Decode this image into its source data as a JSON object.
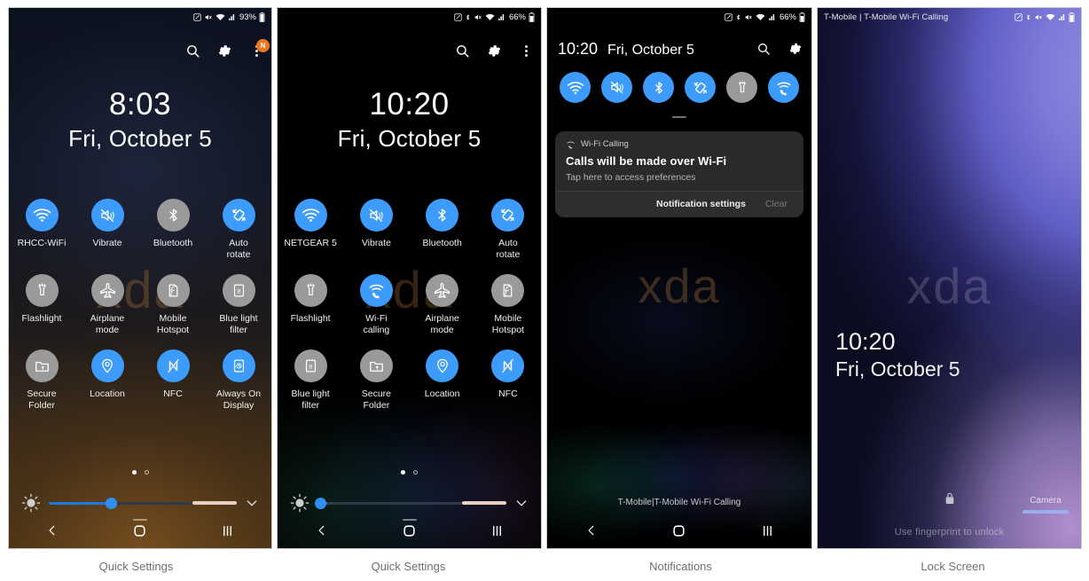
{
  "panels": [
    {
      "caption": "Quick Settings",
      "status": {
        "carrier": "",
        "battery_percent": "93%",
        "icons": [
          "nfc-icon",
          "mute-icon",
          "wifi-icon",
          "signal-icon",
          "battery-icon"
        ]
      },
      "header_icons": [
        "search-icon",
        "gear-icon",
        "more-options-icon"
      ],
      "badge": "N",
      "clock": {
        "time": "8:03",
        "date": "Fri, October 5"
      },
      "watermark": "xda",
      "tiles": [
        {
          "label": "RHCC-WiFi",
          "icon": "wifi-icon",
          "state": "on"
        },
        {
          "label": "Vibrate",
          "icon": "vibrate-icon",
          "state": "on"
        },
        {
          "label": "Bluetooth",
          "icon": "bluetooth-icon",
          "state": "off"
        },
        {
          "label": "Auto\nrotate",
          "icon": "auto-rotate-icon",
          "state": "on"
        },
        {
          "label": "Flashlight",
          "icon": "flashlight-icon",
          "state": "off"
        },
        {
          "label": "Airplane\nmode",
          "icon": "airplane-icon",
          "state": "off"
        },
        {
          "label": "Mobile\nHotspot",
          "icon": "hotspot-icon",
          "state": "off"
        },
        {
          "label": "Blue light\nfilter",
          "icon": "blue-light-filter-icon",
          "state": "off"
        },
        {
          "label": "Secure\nFolder",
          "icon": "secure-folder-icon",
          "state": "off"
        },
        {
          "label": "Location",
          "icon": "location-icon",
          "state": "on"
        },
        {
          "label": "NFC",
          "icon": "nfc-icon",
          "state": "on"
        },
        {
          "label": "Always On\nDisplay",
          "icon": "always-on-display-icon",
          "state": "on"
        }
      ],
      "pager": {
        "pages": 2,
        "active": 0
      },
      "brightness": {
        "value_percent": 33
      },
      "nav": [
        "back-button",
        "home-button",
        "recents-button"
      ]
    },
    {
      "caption": "Quick Settings",
      "status": {
        "carrier": "",
        "battery_percent": "66%",
        "icons": [
          "nfc-icon",
          "bluetooth-icon",
          "mute-icon",
          "wifi-icon",
          "signal-icon",
          "battery-icon"
        ]
      },
      "header_icons": [
        "search-icon",
        "gear-icon",
        "more-options-icon"
      ],
      "badge": "",
      "clock": {
        "time": "10:20",
        "date": "Fri, October 5"
      },
      "watermark": "xda",
      "tiles": [
        {
          "label": "NETGEAR 5",
          "icon": "wifi-icon",
          "state": "on"
        },
        {
          "label": "Vibrate",
          "icon": "vibrate-icon",
          "state": "on"
        },
        {
          "label": "Bluetooth",
          "icon": "bluetooth-icon",
          "state": "on"
        },
        {
          "label": "Auto\nrotate",
          "icon": "auto-rotate-icon",
          "state": "on"
        },
        {
          "label": "Flashlight",
          "icon": "flashlight-icon",
          "state": "off"
        },
        {
          "label": "Wi-Fi\ncalling",
          "icon": "wifi-calling-icon",
          "state": "on"
        },
        {
          "label": "Airplane\nmode",
          "icon": "airplane-icon",
          "state": "off"
        },
        {
          "label": "Mobile\nHotspot",
          "icon": "hotspot-icon",
          "state": "off"
        },
        {
          "label": "Blue light\nfilter",
          "icon": "blue-light-filter-icon",
          "state": "off"
        },
        {
          "label": "Secure\nFolder",
          "icon": "secure-folder-icon",
          "state": "off"
        },
        {
          "label": "Location",
          "icon": "location-icon",
          "state": "on"
        },
        {
          "label": "NFC",
          "icon": "nfc-icon",
          "state": "on"
        }
      ],
      "pager": {
        "pages": 2,
        "active": 0
      },
      "brightness": {
        "value_percent": 5
      },
      "nav": [
        "back-button",
        "home-button",
        "recents-button"
      ]
    },
    {
      "caption": "Notifications",
      "status": {
        "carrier": "",
        "battery_percent": "66%",
        "icons": [
          "nfc-icon",
          "bluetooth-icon",
          "mute-icon",
          "wifi-icon",
          "signal-icon",
          "battery-icon"
        ]
      },
      "header_icons": [
        "search-icon",
        "gear-icon"
      ],
      "clock_inline": {
        "time": "10:20",
        "date": "Fri, October 5"
      },
      "watermark": "xda",
      "mini_tiles": [
        {
          "icon": "wifi-icon",
          "state": "on"
        },
        {
          "icon": "vibrate-icon",
          "state": "on"
        },
        {
          "icon": "bluetooth-icon",
          "state": "on"
        },
        {
          "icon": "auto-rotate-icon",
          "state": "on"
        },
        {
          "icon": "flashlight-icon",
          "state": "off"
        },
        {
          "icon": "wifi-calling-icon",
          "state": "on"
        }
      ],
      "notification": {
        "app": "Wi-Fi Calling",
        "app_icon": "wifi-calling-icon",
        "title": "Calls will be made over Wi-Fi",
        "subtitle": "Tap here to access preferences",
        "action_primary": "Notification settings",
        "action_secondary": "Clear"
      },
      "carrier_bottom": "T-Mobile|T-Mobile Wi-Fi Calling",
      "nav": [
        "back-button",
        "home-button",
        "recents-button"
      ]
    },
    {
      "caption": "Lock Screen",
      "status": {
        "carrier": "T-Mobile | T-Mobile Wi-Fi Calling",
        "battery_percent": "",
        "icons": [
          "nfc-icon",
          "bluetooth-icon",
          "mute-icon",
          "wifi-icon",
          "signal-icon",
          "battery-icon"
        ]
      },
      "watermark": "xda",
      "clock": {
        "time": "10:20",
        "date": "Fri, October 5"
      },
      "lock_icon": "lock-icon",
      "hint": "Use fingerprint to unlock",
      "camera_label": "Camera"
    }
  ],
  "colors": {
    "accent_on": "#3d9bfb",
    "tile_off": "#9a9a9a",
    "badge": "#f0761e",
    "slider_fill": "#1a7ae8",
    "caption_text": "#6f6f6f"
  }
}
